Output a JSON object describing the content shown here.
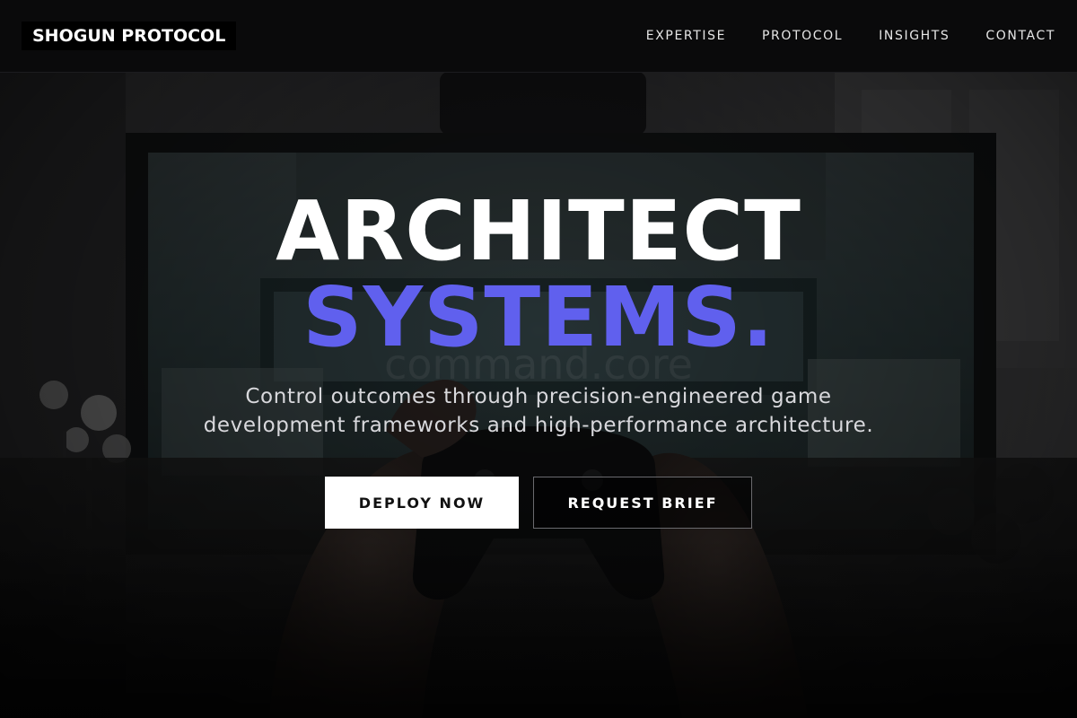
{
  "header": {
    "logo": "SHOGUN PROTOCOL",
    "nav": [
      {
        "label": "EXPERTISE"
      },
      {
        "label": "PROTOCOL"
      },
      {
        "label": "INSIGHTS"
      },
      {
        "label": "CONTACT"
      }
    ]
  },
  "hero": {
    "headline_line1": "ARCHITECT",
    "headline_line2": "SYSTEMS.",
    "subtitle_line1": "Control outcomes through precision-engineered game",
    "subtitle_line2": "development frameworks and high-performance architecture.",
    "primary_button": "DEPLOY NOW",
    "secondary_button": "REQUEST BRIEF",
    "background_image": "gamer-holding-controller-in-front-of-tv"
  },
  "colors": {
    "accent": "#6060ee",
    "header_bg": "#0a0a0b",
    "primary_button_bg": "#ffffff",
    "text": "#ffffff"
  }
}
